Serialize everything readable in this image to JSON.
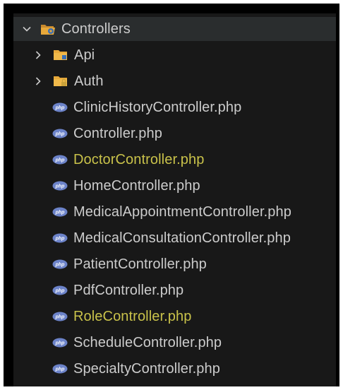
{
  "explorer": {
    "root": {
      "label": "Controllers",
      "expanded": true
    },
    "folders": [
      {
        "label": "Api",
        "expanded": false
      },
      {
        "label": "Auth",
        "expanded": false
      }
    ],
    "files": [
      {
        "label": "ClinicHistoryController.php",
        "modified": false
      },
      {
        "label": "Controller.php",
        "modified": false
      },
      {
        "label": "DoctorController.php",
        "modified": true
      },
      {
        "label": "HomeController.php",
        "modified": false
      },
      {
        "label": "MedicalAppointmentController.php",
        "modified": false
      },
      {
        "label": "MedicalConsultationController.php",
        "modified": false
      },
      {
        "label": "PatientController.php",
        "modified": false
      },
      {
        "label": "PdfController.php",
        "modified": false
      },
      {
        "label": "RoleController.php",
        "modified": true
      },
      {
        "label": "ScheduleController.php",
        "modified": false
      },
      {
        "label": "SpecialtyController.php",
        "modified": false
      }
    ],
    "file_icon": "php-file-icon"
  },
  "colors": {
    "background": "#181818",
    "text": "#cccccc",
    "modified_text": "#c9c24a",
    "folder": "#e8a93a",
    "php_icon": "#6c83c9"
  }
}
